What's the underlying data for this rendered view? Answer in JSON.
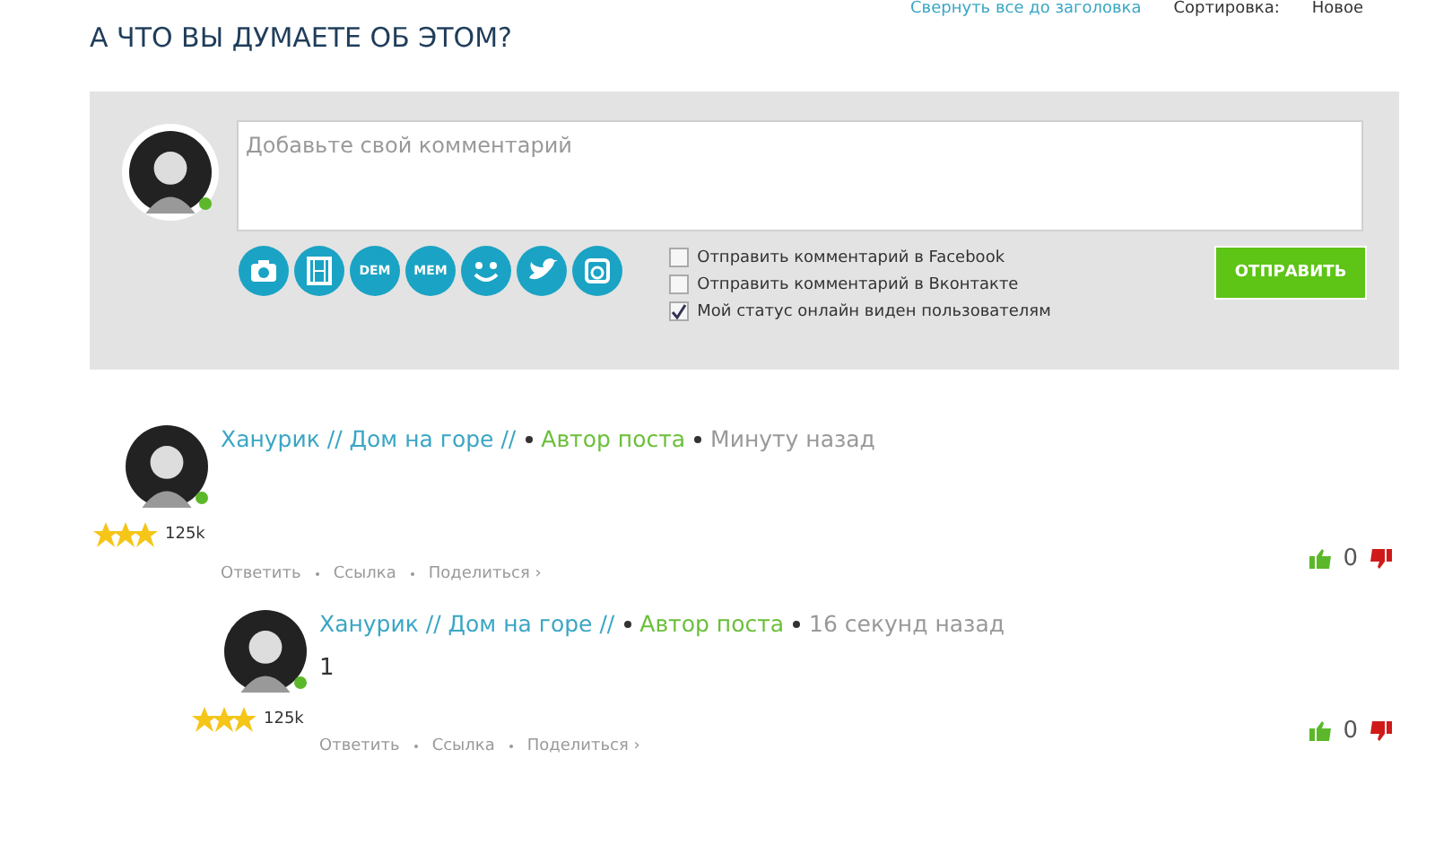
{
  "top_links": {
    "collapse": "Свернуть все до заголовка",
    "sort_label": "Сортировка:",
    "sort_value": "Новое"
  },
  "heading": "А ЧТО ВЫ ДУМАЕТЕ ОБ ЭТОМ?",
  "composer": {
    "placeholder": "Добавьте свой комментарий",
    "online": true,
    "tools": [
      {
        "kind": "camera"
      },
      {
        "kind": "film"
      },
      {
        "kind": "text",
        "label": "DEM"
      },
      {
        "kind": "text",
        "label": "MEM"
      },
      {
        "kind": "smile"
      },
      {
        "kind": "bird"
      },
      {
        "kind": "square-camera"
      }
    ],
    "options": [
      {
        "label": "Отправить комментарий в Facebook",
        "checked": false
      },
      {
        "label": "Отправить комментарий в Вконтакте",
        "checked": false
      },
      {
        "label": "Мой статус онлайн виден пользователям",
        "checked": true
      }
    ],
    "submit": "ОТПРАВИТЬ"
  },
  "comments": [
    {
      "author": "Ханурик // Дом на горе //",
      "role": "Автор поста",
      "time": "Минуту назад",
      "online": true,
      "stars": 3,
      "rating": "125k",
      "actions": [
        "Ответить",
        "Ссылка",
        "Поделиться ›"
      ],
      "score": "0",
      "replies": [
        {
          "author": "Ханурик // Дом на горе //",
          "role": "Автор поста",
          "time": "16 секунд назад",
          "online": true,
          "stars": 3,
          "rating": "125k",
          "text": "1",
          "actions": [
            "Ответить",
            "Ссылка",
            "Поделиться ›"
          ],
          "score": "0"
        }
      ]
    }
  ]
}
